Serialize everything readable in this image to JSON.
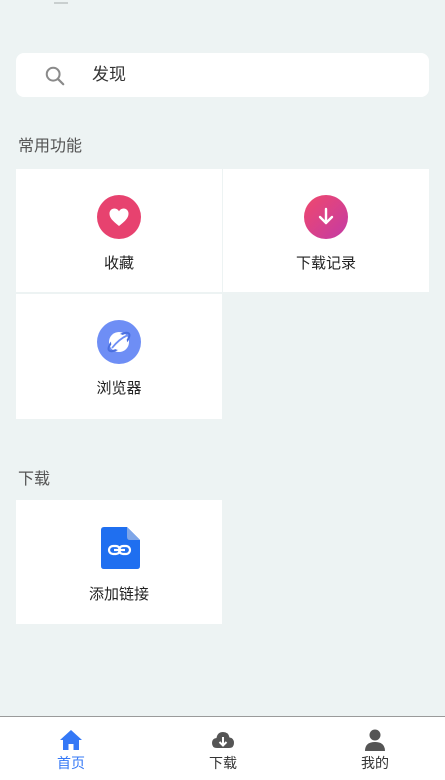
{
  "search": {
    "placeholder": "发现"
  },
  "sections": {
    "common": {
      "title": "常用功能"
    },
    "download": {
      "title": "下载"
    }
  },
  "tiles": {
    "favorites": {
      "label": "收藏",
      "icon": "heart-icon",
      "color": "#e7426f"
    },
    "download_history": {
      "label": "下载记录",
      "icon": "download-arrow-icon",
      "color": "#d93a8c"
    },
    "browser": {
      "label": "浏览器",
      "icon": "planet-icon",
      "color": "#6e8ef5"
    },
    "add_link": {
      "label": "添加链接",
      "icon": "link-file-icon",
      "color": "#1f6ff0"
    }
  },
  "tabbar": {
    "active_color": "#3478f6",
    "inactive_color": "#555555",
    "items": [
      {
        "label": "首页",
        "icon": "home-icon",
        "active": true
      },
      {
        "label": "下载",
        "icon": "cloud-download-icon",
        "active": false
      },
      {
        "label": "我的",
        "icon": "user-icon",
        "active": false
      }
    ]
  }
}
